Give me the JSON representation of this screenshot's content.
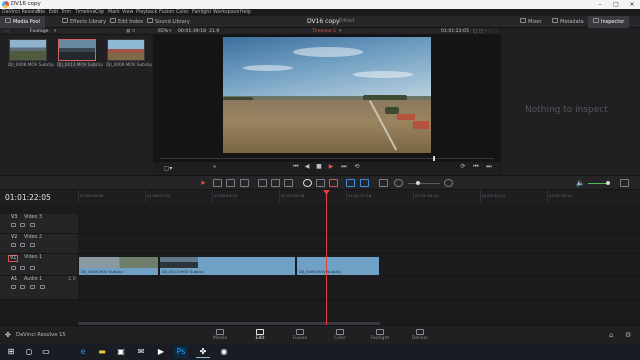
{
  "titlebar": {
    "title": "DV16 copy"
  },
  "menu": [
    "DaVinci Resolve",
    "File",
    "Edit",
    "Trim",
    "Timeline",
    "Clip",
    "Mark",
    "View",
    "Playback",
    "Fusion",
    "Color",
    "Fairlight",
    "Workspace",
    "Help"
  ],
  "toolbar": {
    "media_pool": "Media Pool",
    "effects_library": "Effects Library",
    "edit_index": "Edit Index",
    "sound_library": "Sound Library",
    "project_title": "DV16 copy",
    "project_status": "Edited",
    "mixer": "Mixer",
    "metadata": "Metadata",
    "inspector": "Inspector"
  },
  "media_pool": {
    "bin": "Footage",
    "clips": [
      {
        "name": "DJI_0008.MOV Subclip"
      },
      {
        "name": "DJI_0013.MOV Subclip"
      },
      {
        "name": "DJI_0009.MOV Subclip"
      }
    ]
  },
  "viewer": {
    "zoom": "65%",
    "source_timecode": "00:01:39:18",
    "frame_rate": "21.9",
    "timeline_name": "Timeline 1",
    "record_timecode": "01:01:22:05"
  },
  "inspector": {
    "empty_text": "Nothing to inspect"
  },
  "timeline": {
    "timecode": "01:01:22:05",
    "ruler": [
      "01:00:00:00",
      "01:00:21:22",
      "01:00:43:20",
      "01:01:05:18",
      "01:01:27:16",
      "01:01:49:14",
      "01:02:11:12",
      "01:02:33:10"
    ],
    "tracks": [
      {
        "id": "V3",
        "name": "Video 3"
      },
      {
        "id": "V2",
        "name": "Video 2"
      },
      {
        "id": "V1",
        "name": "Video 1"
      },
      {
        "id": "A1",
        "name": "Audio 1",
        "level": "2.0"
      }
    ],
    "clips": [
      {
        "name": "DJI_0008.MOV Subclip"
      },
      {
        "name": "DJI_0013.MOV Subclip"
      },
      {
        "name": "DJI_0009.MOV Subclip"
      }
    ]
  },
  "pages": [
    "Media",
    "Edit",
    "Fusion",
    "Color",
    "Fairlight",
    "Deliver"
  ],
  "resolve_label": "DaVinci Resolve 15",
  "accent": "#e43b3b",
  "clip_color": "#6fa0c6"
}
